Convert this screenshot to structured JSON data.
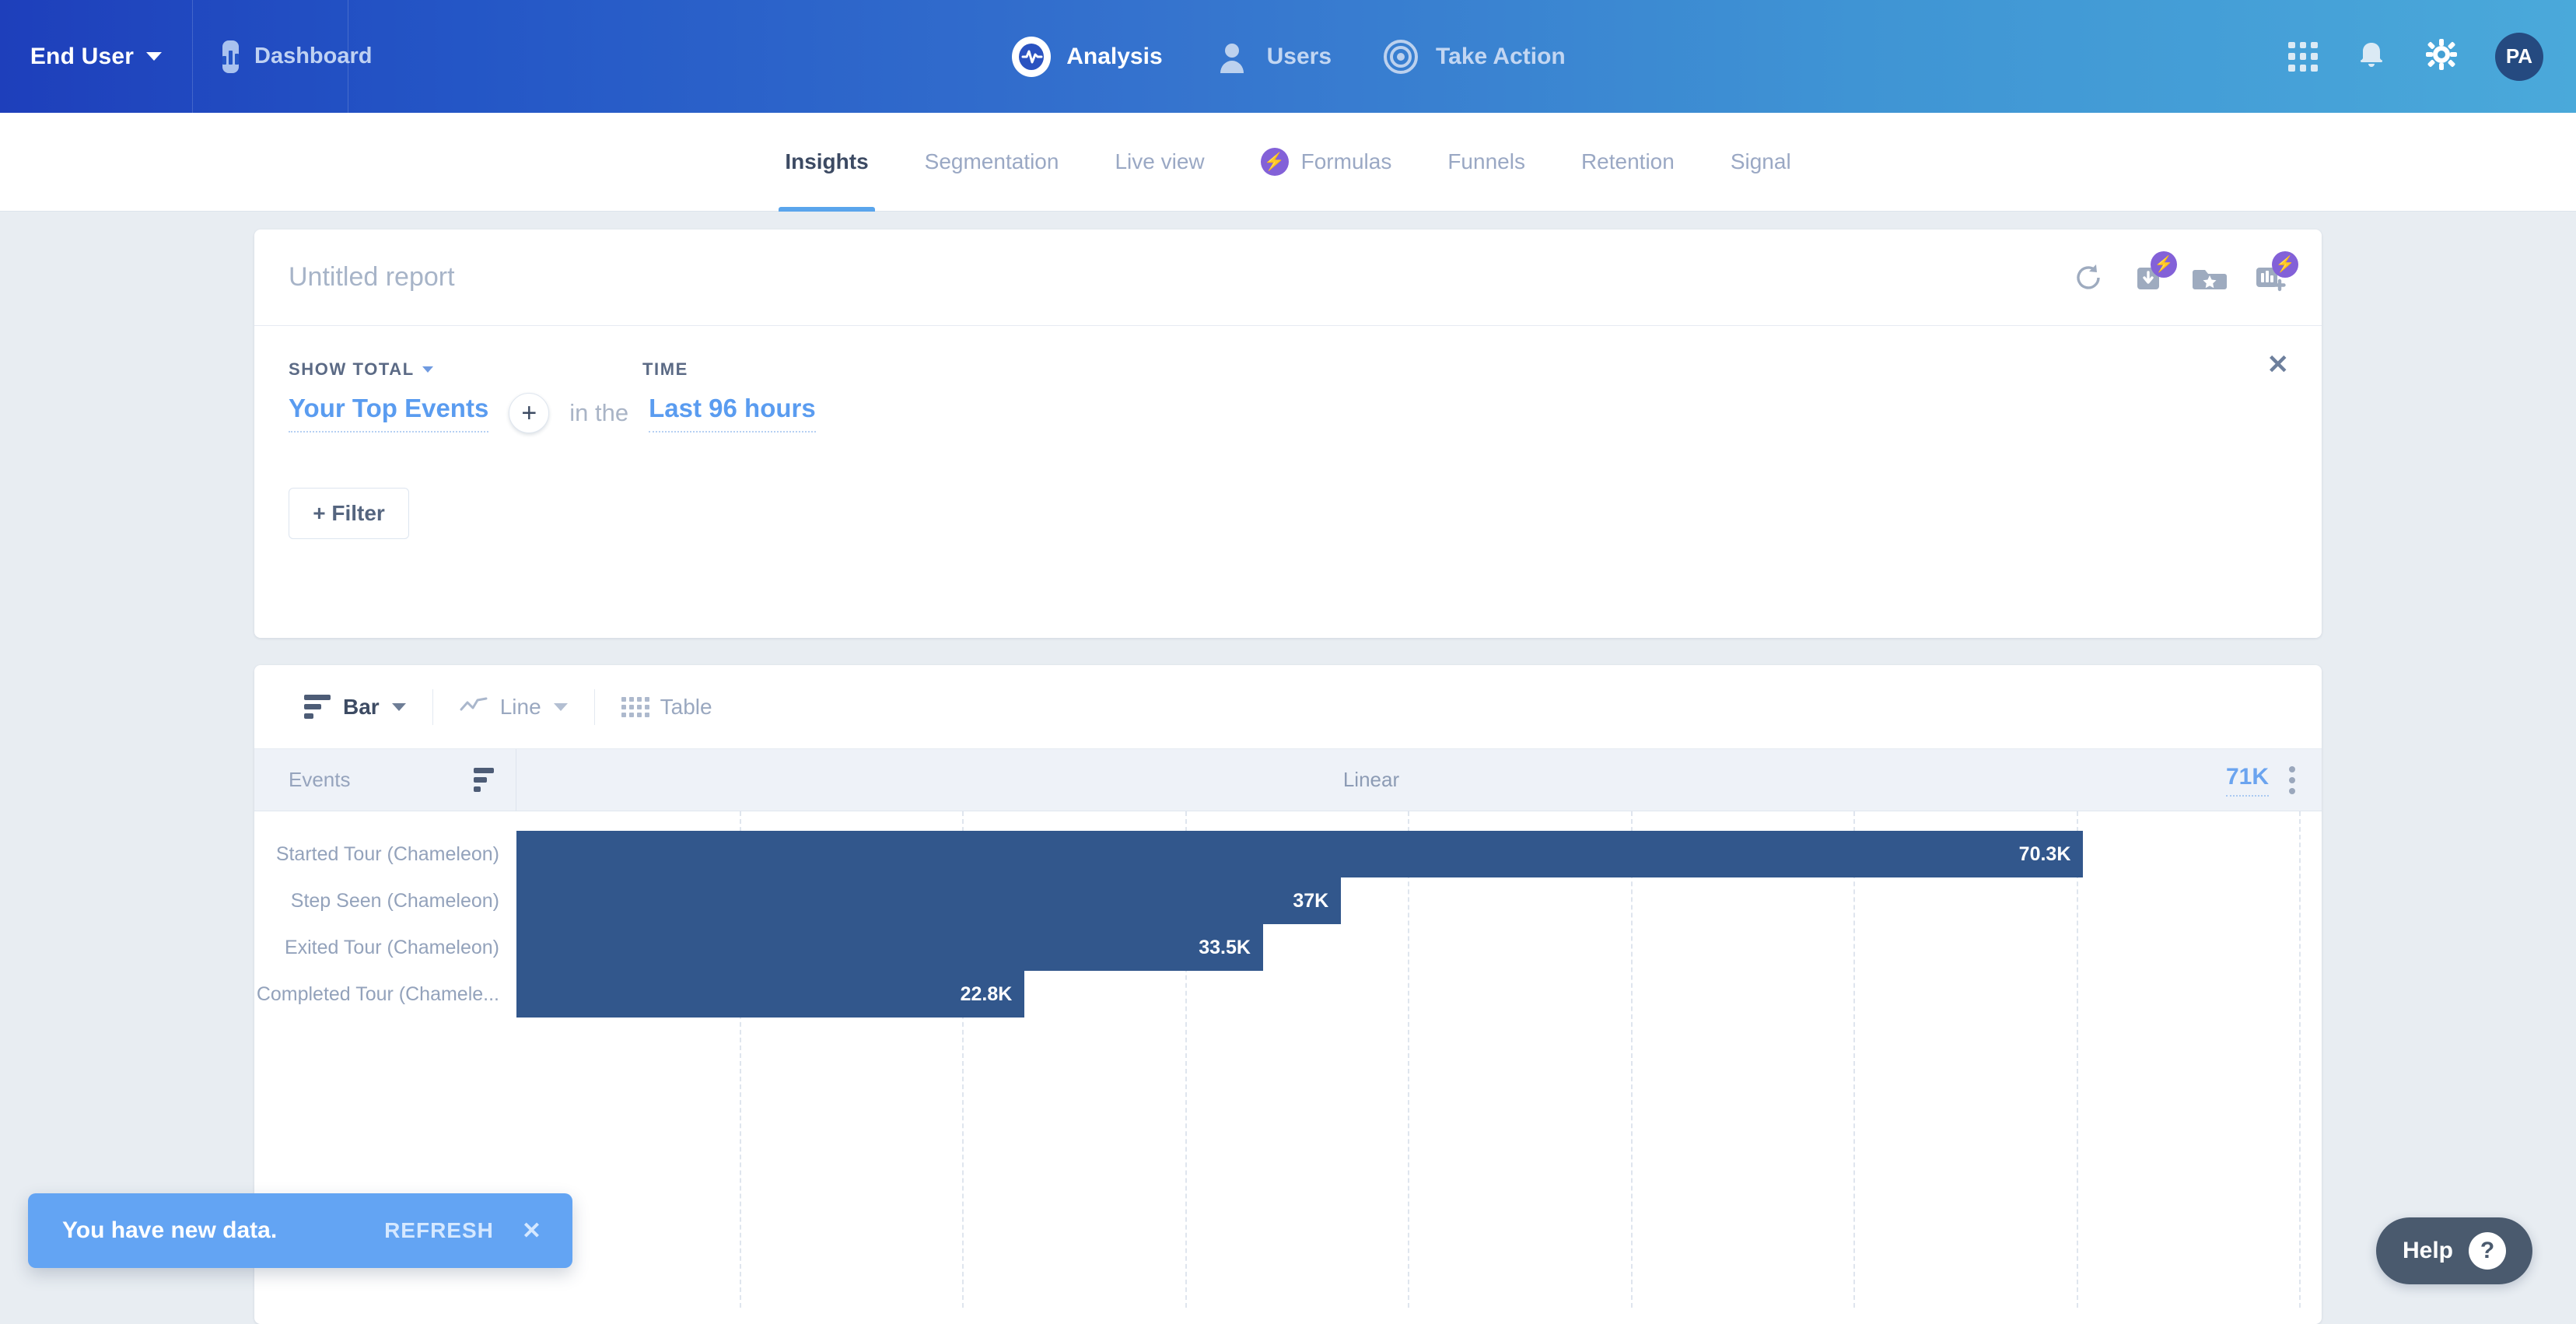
{
  "topbar": {
    "workspace_label": "End User",
    "workspace_icon": "chevron-down-icon",
    "dashboard_label": "Dashboard",
    "nav": [
      {
        "label": "Analysis",
        "icon": "pulse-icon",
        "active": true
      },
      {
        "label": "Users",
        "icon": "person-icon",
        "active": false
      },
      {
        "label": "Take Action",
        "icon": "target-icon",
        "active": false
      }
    ],
    "right_icons": [
      "apps-grid-icon",
      "bell-icon",
      "gear-icon"
    ],
    "avatar_initials": "PA",
    "gradient_start": "#1e3fbb",
    "gradient_end": "#4aa9da"
  },
  "subnav": {
    "items": [
      {
        "label": "Insights",
        "active": true,
        "badge": false
      },
      {
        "label": "Segmentation",
        "active": false,
        "badge": false
      },
      {
        "label": "Live view",
        "active": false,
        "badge": false
      },
      {
        "label": "Formulas",
        "active": false,
        "badge": true
      },
      {
        "label": "Funnels",
        "active": false,
        "badge": false
      },
      {
        "label": "Retention",
        "active": false,
        "badge": false
      },
      {
        "label": "Signal",
        "active": false,
        "badge": false
      }
    ],
    "badge_glyph": "⚡",
    "badge_color": "#8361d8",
    "active_underline_color": "#5aa5ec"
  },
  "report": {
    "title_placeholder": "Untitled report",
    "title_value": "",
    "toolbar": [
      {
        "name": "refresh-icon",
        "badge": ""
      },
      {
        "name": "download-icon",
        "badge": "⚡"
      },
      {
        "name": "save-folder-icon",
        "badge": ""
      },
      {
        "name": "add-to-dashboard-icon",
        "badge": "⚡"
      }
    ]
  },
  "query": {
    "close_label": "✕",
    "measure_label": "SHOW TOTAL",
    "time_label": "TIME",
    "event_value": "Your Top Events",
    "add_event_label": "+",
    "connector_text": "in the",
    "time_value": "Last 96 hours",
    "filter_label": "+ Filter"
  },
  "chart_toolbar": {
    "items": [
      {
        "label": "Bar",
        "icon": "bar-chart-icon",
        "active": true,
        "has_chevron": true
      },
      {
        "label": "Line",
        "icon": "line-chart-icon",
        "active": false,
        "has_chevron": true
      },
      {
        "label": "Table",
        "icon": "table-grid-icon",
        "active": false,
        "has_chevron": false
      }
    ]
  },
  "chart_header": {
    "events_label": "Events",
    "sort_icon": "sort-icon",
    "scale_label": "Linear",
    "total_value": "71K",
    "menu_icon": "kebab-menu-icon"
  },
  "chart_data": {
    "type": "bar",
    "orientation": "horizontal",
    "title": "",
    "xlabel": "",
    "ylabel": "Events",
    "scale": "Linear",
    "total": "71K",
    "total_numeric": 71000,
    "grid": true,
    "legend": "none",
    "xlim": [
      0,
      81000
    ],
    "bar_color": "#32578c",
    "categories": [
      "Started Tour (Chameleon)",
      "Step Seen (Chameleon)",
      "Exited Tour (Chameleon)",
      "Completed Tour (Chamele..."
    ],
    "values": [
      70300,
      37000,
      33500,
      22800
    ],
    "value_labels": [
      "70.3K",
      "37K",
      "33.5K",
      "22.8K"
    ],
    "gridline_values": [
      10000,
      20000,
      30000,
      40000,
      50000,
      60000,
      70000,
      80000
    ]
  },
  "toast": {
    "message": "You have new data.",
    "action_label": "REFRESH",
    "close_label": "✕",
    "color": "#63a4f3"
  },
  "help": {
    "label": "Help",
    "icon_glyph": "?"
  }
}
